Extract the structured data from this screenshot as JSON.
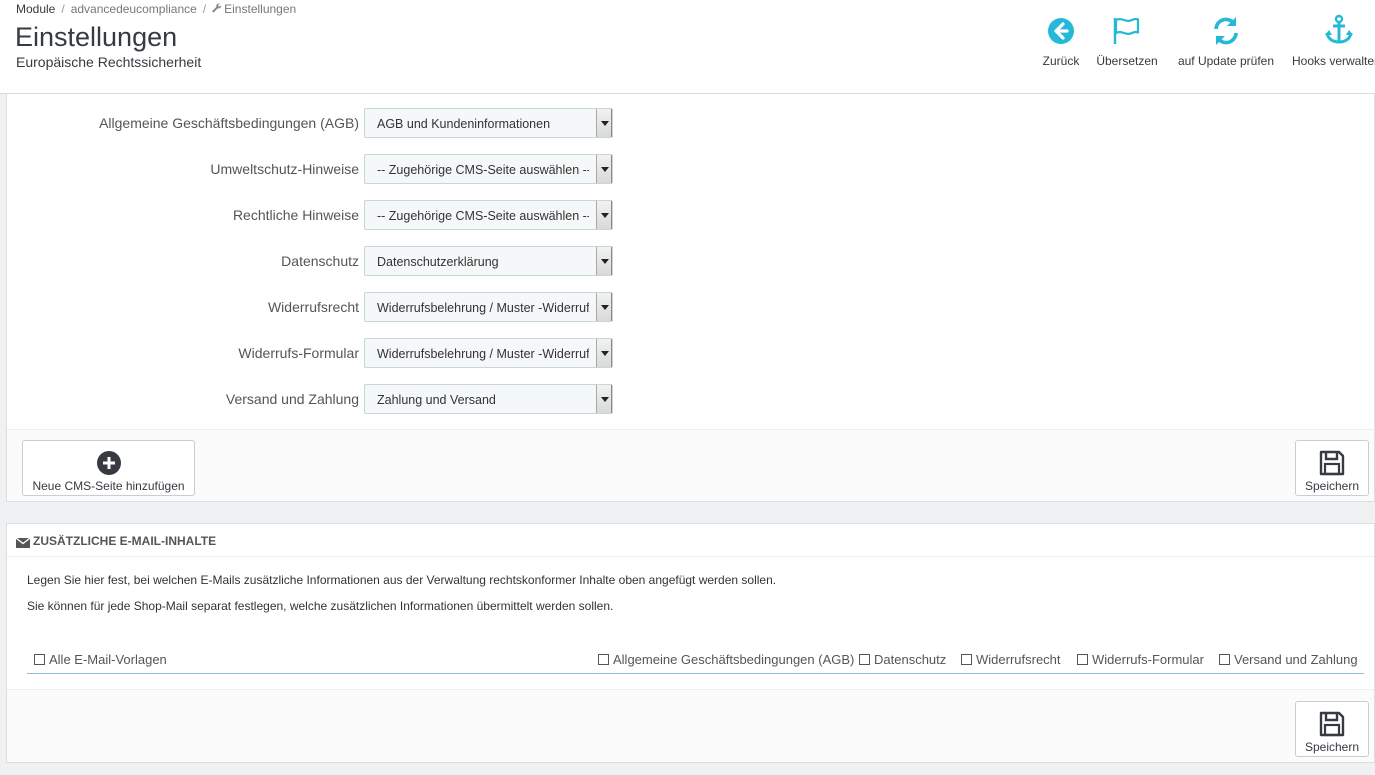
{
  "breadcrumb": {
    "item1": "Module",
    "item2": "advancedeucompliance",
    "item3": "Einstellungen"
  },
  "header": {
    "title": "Einstellungen",
    "subtitle": "Europäische Rechtssicherheit"
  },
  "toolbar": {
    "back": "Zurück",
    "translate": "Übersetzen",
    "update": "auf Update prüfen",
    "hooks": "Hooks verwalten"
  },
  "colors": {
    "accent": "#25b9d7",
    "text_dark": "#363a41"
  },
  "form": {
    "rows": [
      {
        "label": "Allgemeine Geschäftsbedingungen (AGB)",
        "value": "AGB und Kundeninformationen"
      },
      {
        "label": "Umweltschutz-Hinweise",
        "value": "-- Zugehörige CMS-Seite auswählen --"
      },
      {
        "label": "Rechtliche Hinweise",
        "value": "-- Zugehörige CMS-Seite auswählen --"
      },
      {
        "label": "Datenschutz",
        "value": "Datenschutzerklärung"
      },
      {
        "label": "Widerrufsrecht",
        "value": "Widerrufsbelehrung / Muster -Widerruf"
      },
      {
        "label": "Widerrufs-Formular",
        "value": "Widerrufsbelehrung / Muster -Widerruf"
      },
      {
        "label": "Versand und Zahlung",
        "value": "Zahlung und Versand"
      }
    ],
    "add_cms_label": "Neue CMS-Seite hinzufügen",
    "save_label": "Speichern"
  },
  "email_panel": {
    "title": "ZUSÄTZLICHE E-MAIL-INHALTE",
    "help1": "Legen Sie hier fest, bei welchen E-Mails zusätzliche Informationen aus der Verwaltung rechtskonformer Inhalte oben angefügt werden sollen.",
    "help2": "Sie können für jede Shop-Mail separat festlegen, welche zusätzlichen Informationen übermittelt werden sollen.",
    "columns": [
      "Alle E-Mail-Vorlagen",
      "Allgemeine Geschäftsbedingungen (AGB)",
      "Datenschutz",
      "Widerrufsrecht",
      "Widerrufs-Formular",
      "Versand und Zahlung"
    ],
    "save_label": "Speichern"
  },
  "icons": [
    "arrow-left-circle-icon",
    "flag-icon",
    "refresh-icon",
    "anchor-icon",
    "plus-circle-icon",
    "save-icon",
    "envelope-icon",
    "wrench-icon"
  ]
}
